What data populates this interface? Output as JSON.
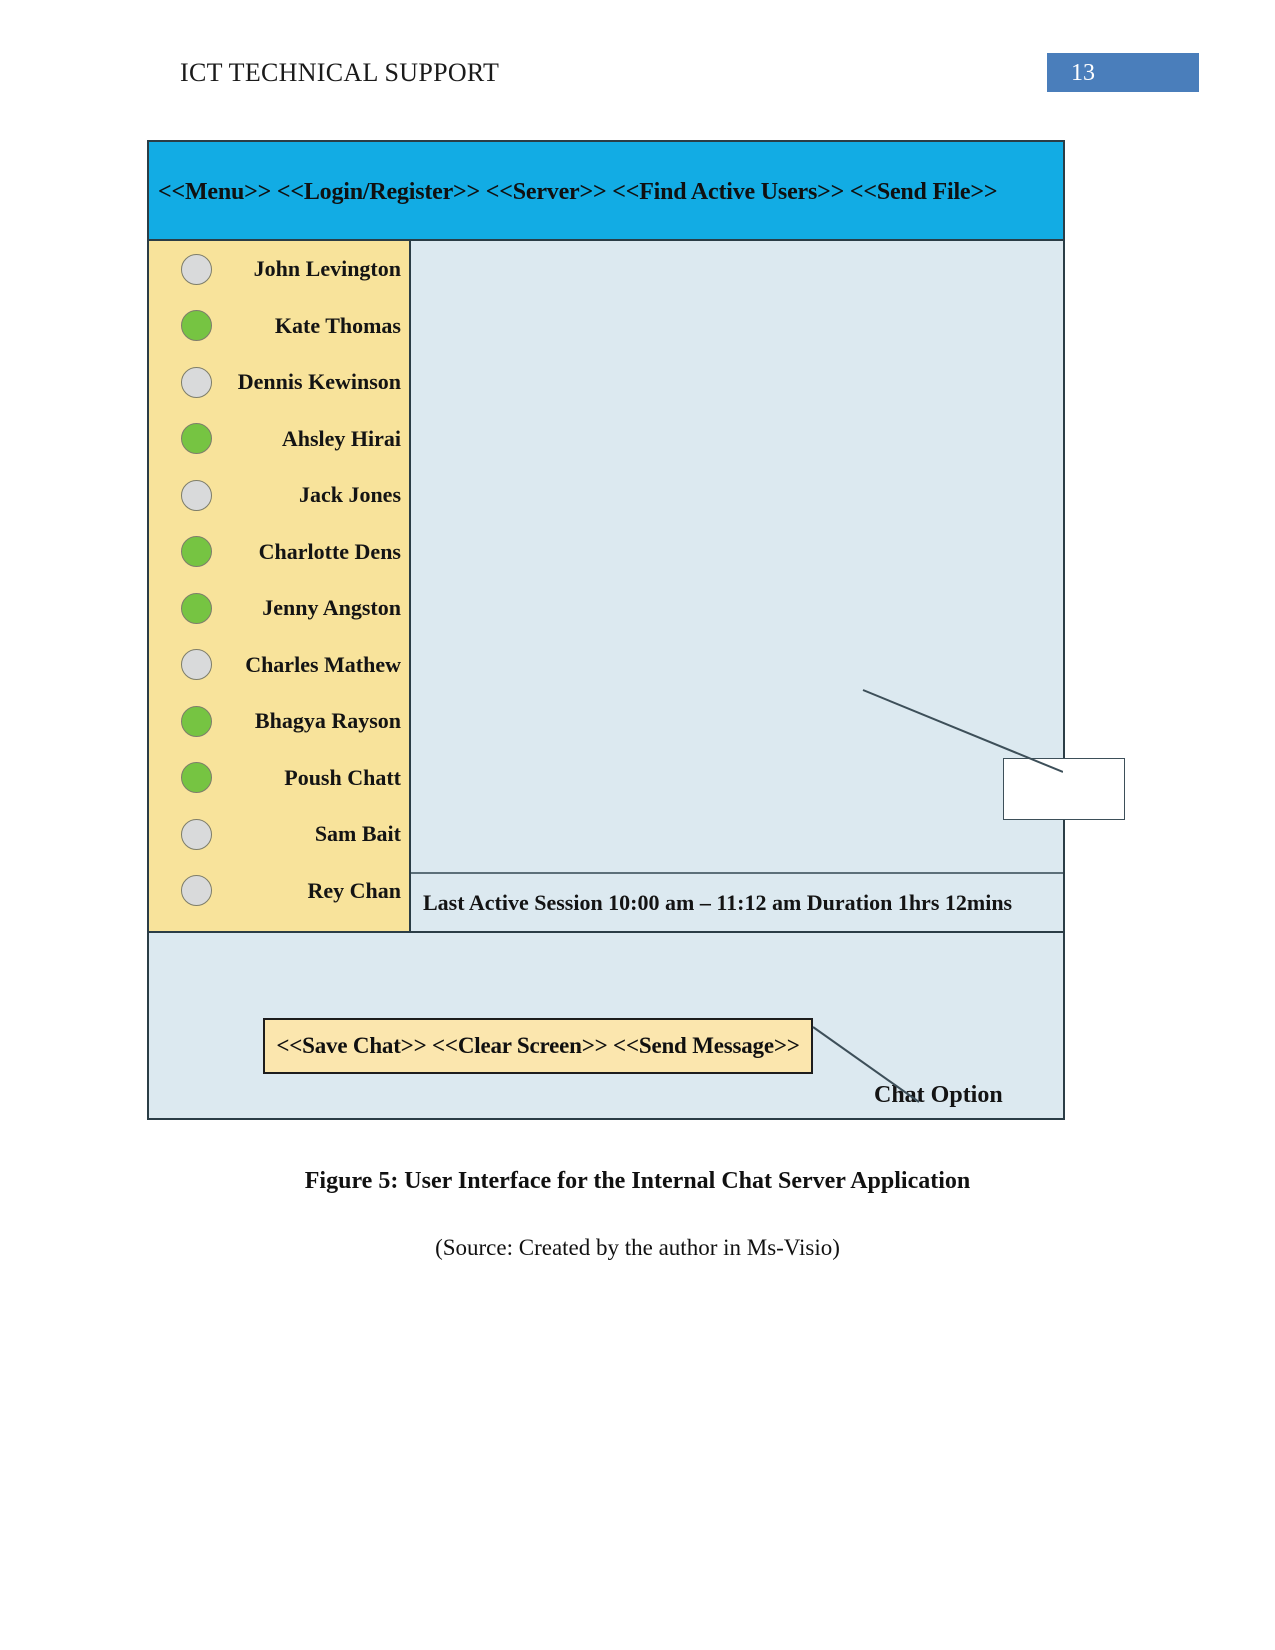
{
  "document": {
    "header_title": "ICT TECHNICAL SUPPORT",
    "page_number": "13",
    "figure_caption": "Figure 5: User Interface for the Internal Chat Server Application",
    "source_caption": "(Source: Created by the author in Ms-Visio)",
    "accent_badge_color": "#4a7ebb"
  },
  "mockup": {
    "menu_bar": {
      "text": "<<Menu>> <<Login/Register>> <<Server>> <<Find Active Users>> <<Send File>>",
      "background_color": "#12ace4",
      "items": [
        "<<Menu>>",
        "<<Login/Register>>",
        "<<Server>>",
        "<<Find Active Users>>",
        "<<Send File>>"
      ]
    },
    "sidebar": {
      "background_color": "#f8e39b",
      "online_color": "#76c442",
      "offline_color": "#d9dadb",
      "users": [
        {
          "name": "John Levington",
          "status": "offline"
        },
        {
          "name": "Kate Thomas",
          "status": "online"
        },
        {
          "name": "Dennis Kewinson",
          "status": "offline"
        },
        {
          "name": "Ahsley Hirai",
          "status": "online"
        },
        {
          "name": "Jack Jones",
          "status": "offline"
        },
        {
          "name": "Charlotte Dens",
          "status": "online"
        },
        {
          "name": "Jenny Angston",
          "status": "online"
        },
        {
          "name": "Charles Mathew",
          "status": "offline"
        },
        {
          "name": "Bhagya Rayson",
          "status": "online"
        },
        {
          "name": "Poush Chatt",
          "status": "online"
        },
        {
          "name": "Sam Bait",
          "status": "offline"
        },
        {
          "name": "Rey Chan",
          "status": "offline"
        }
      ]
    },
    "chat_area": {
      "background_color": "#dce9f0",
      "callout_box_label": ""
    },
    "session_bar": {
      "text": "Last Active Session 10:00 am – 11:12 am Duration 1hrs 12mins"
    },
    "action_bar": {
      "text": "<<Save Chat>> <<Clear Screen>> <<Send Message>>",
      "background_color": "#fbe6ae",
      "items": [
        "<<Save Chat>>",
        "<<Clear Screen>>",
        "<<Send Message>>"
      ]
    },
    "annotations": {
      "chat_option_label": "Chat Option"
    }
  }
}
